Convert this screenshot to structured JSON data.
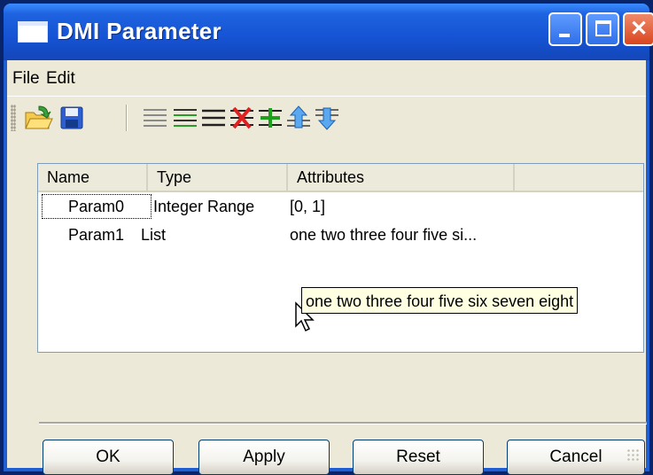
{
  "window": {
    "title": "DMI Parameter"
  },
  "menu": {
    "file": "File",
    "edit": "Edit"
  },
  "toolbar": {
    "icons": [
      "open-folder-icon",
      "save-icon",
      "align-list-icon",
      "add-row-icon",
      "insert-row-icon",
      "delete-row-icon",
      "insert-plus-icon",
      "move-up-icon",
      "move-down-icon"
    ]
  },
  "table": {
    "columns": [
      "Name",
      "Type",
      "Attributes"
    ],
    "rows": [
      {
        "name": "Param0",
        "type": "Integer Range",
        "attributes": "[0, 1]"
      },
      {
        "name": "Param1",
        "type": "List",
        "attributes": "one two three four five si..."
      }
    ]
  },
  "tooltip": {
    "text": "one two three four five six seven eight"
  },
  "buttons": {
    "ok": "OK",
    "apply": "Apply",
    "reset": "Reset",
    "cancel": "Cancel"
  },
  "colors": {
    "titlebar": "#1553d4",
    "client": "#ece9d8",
    "tooltip_bg": "#ffffe1"
  }
}
